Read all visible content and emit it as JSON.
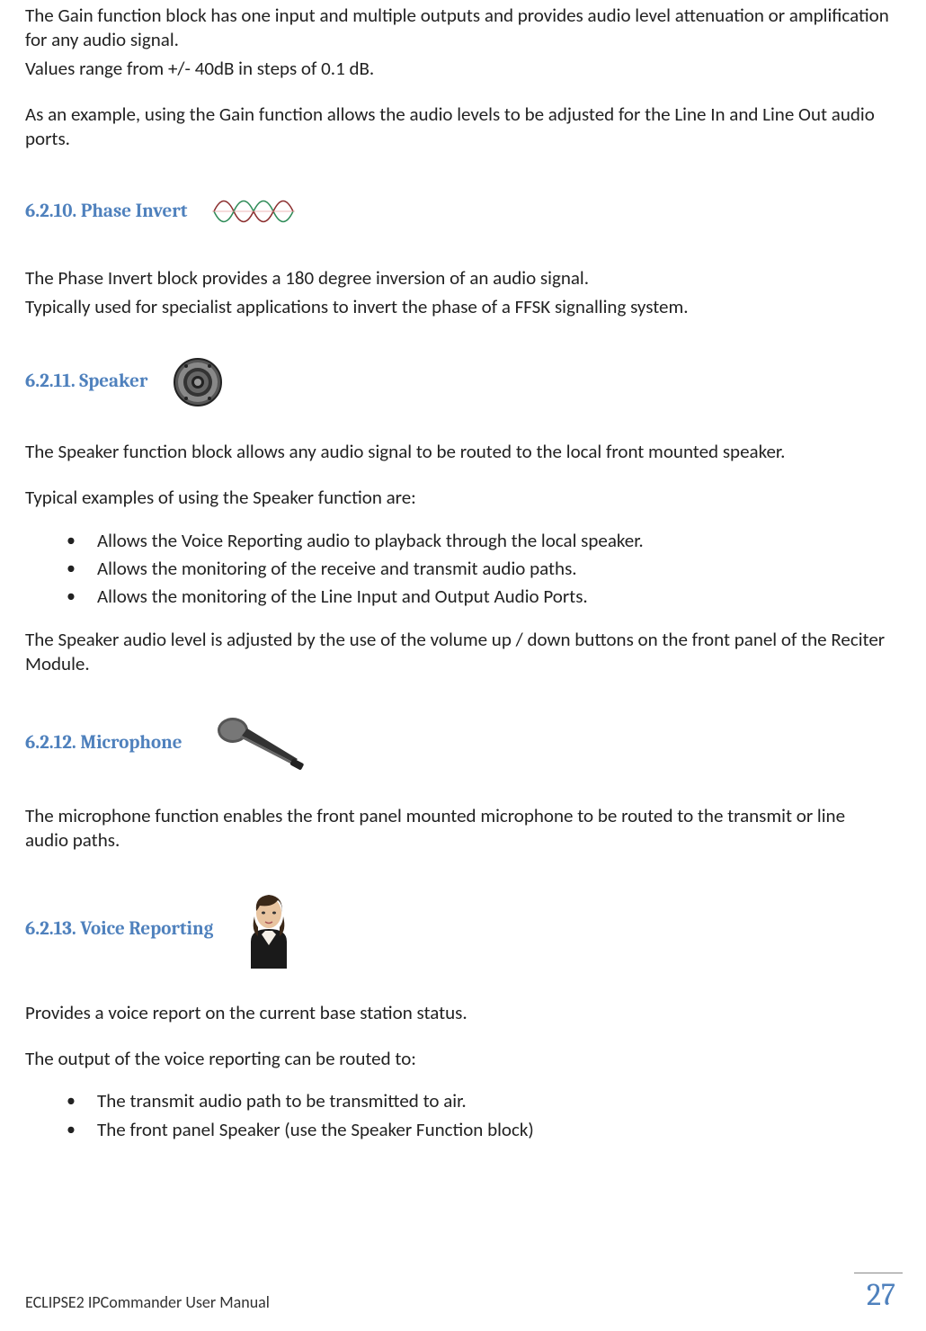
{
  "intro": {
    "p1": "The Gain function block has one input and multiple outputs and provides audio level attenuation or amplification for any audio signal.",
    "p2": "Values range from +/- 40dB in steps of 0.1 dB.",
    "p3": "As an example, using the Gain function allows the audio levels to be adjusted for the Line In and Line Out audio ports."
  },
  "sections": {
    "phase_invert": {
      "heading": "6.2.10. Phase Invert",
      "p1": "The Phase Invert block provides a 180 degree inversion of an audio signal.",
      "p2": "Typically used for specialist applications to invert the phase of a FFSK signalling system."
    },
    "speaker": {
      "heading": "6.2.11. Speaker",
      "p1": "The Speaker function block allows any audio signal to be routed to the local front mounted speaker.",
      "p2": "Typical examples of using the Speaker function are:",
      "bullets": [
        "Allows the Voice Reporting audio to playback through the local speaker.",
        "Allows the monitoring of the receive and transmit audio paths.",
        "Allows the monitoring of the Line Input and Output Audio Ports."
      ],
      "p3": "The Speaker audio level is adjusted by the use of the volume up / down buttons on the front panel of the Reciter Module."
    },
    "microphone": {
      "heading": "6.2.12. Microphone",
      "p1": "The microphone function enables the front panel mounted microphone to be routed to the transmit or line audio paths."
    },
    "voice_reporting": {
      "heading": "6.2.13. Voice Reporting",
      "p1": "Provides a voice report on the current base station status.",
      "p2": "The output of the voice reporting can be routed to:",
      "bullets": [
        "The transmit audio path to be transmitted to air.",
        "The front panel Speaker (use the Speaker Function block)"
      ]
    }
  },
  "footer": {
    "doc_title": "ECLIPSE2 IPCommander User Manual",
    "page": "27"
  }
}
